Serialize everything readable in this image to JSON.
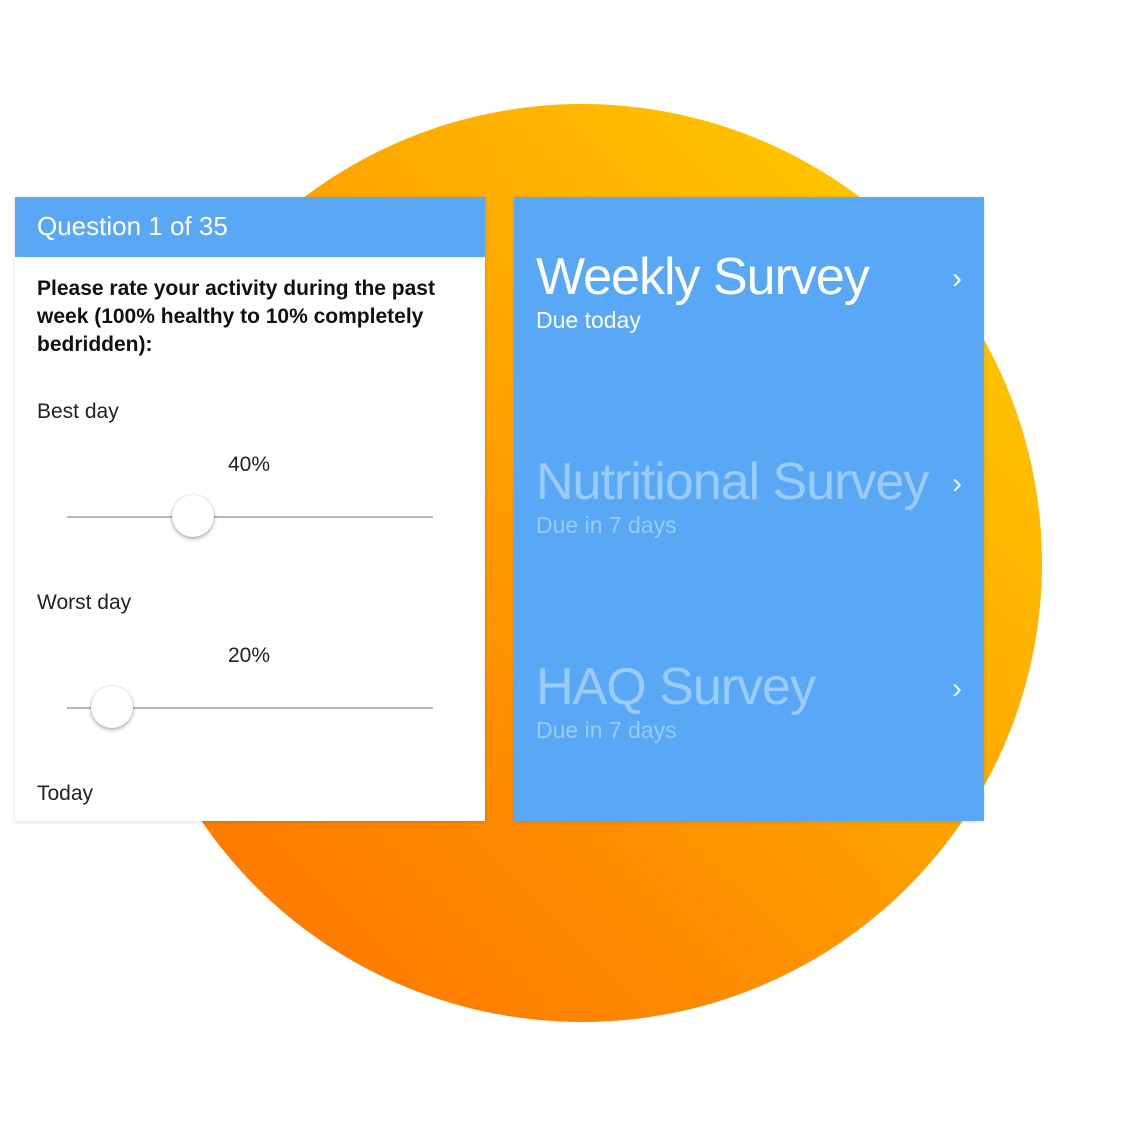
{
  "question_panel": {
    "header": "Question 1 of 35",
    "prompt": "Please rate your activity during the past week (100% healthy to 10% completely bedridden):",
    "items": [
      {
        "label": "Best day",
        "value_text": "40%",
        "level": 0.4
      },
      {
        "label": "Worst day",
        "value_text": "20%",
        "level": 0.2
      },
      {
        "label": "Today"
      }
    ]
  },
  "survey_list": {
    "surveys": [
      {
        "title": "Weekly Survey",
        "due": "Due today",
        "state": "active"
      },
      {
        "title": "Nutritional Survey",
        "due": "Due in 7 days",
        "state": "muted"
      },
      {
        "title": "HAQ Survey",
        "due": "Due in 7 days",
        "state": "muted"
      }
    ],
    "chevron": "›"
  },
  "colors": {
    "header_blue": "#58a8f5",
    "panel_blue": "#58a8f5",
    "circle_gradient": [
      "#ffd200",
      "#ff7000"
    ]
  }
}
